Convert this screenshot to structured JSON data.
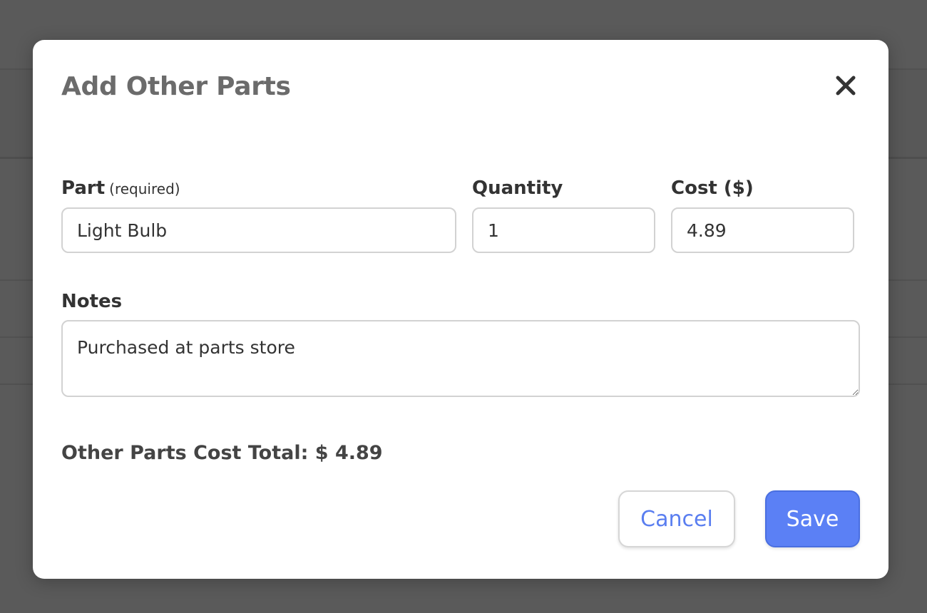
{
  "modal": {
    "title": "Add Other Parts",
    "close_icon": "close-icon"
  },
  "form": {
    "part": {
      "label": "Part",
      "hint": "(required)",
      "value": "Light Bulb"
    },
    "quantity": {
      "label": "Quantity",
      "value": "1"
    },
    "cost": {
      "label": "Cost ($)",
      "value": "4.89"
    },
    "notes": {
      "label": "Notes",
      "value": "Purchased at parts store"
    }
  },
  "summary": {
    "total_text": "Other Parts Cost Total: $ 4.89"
  },
  "actions": {
    "cancel_label": "Cancel",
    "save_label": "Save"
  },
  "colors": {
    "overlay": "#5a5a5a",
    "accent": "#5b80f5",
    "cancel_text": "#5a7ef0",
    "title": "#6b6b6b"
  }
}
